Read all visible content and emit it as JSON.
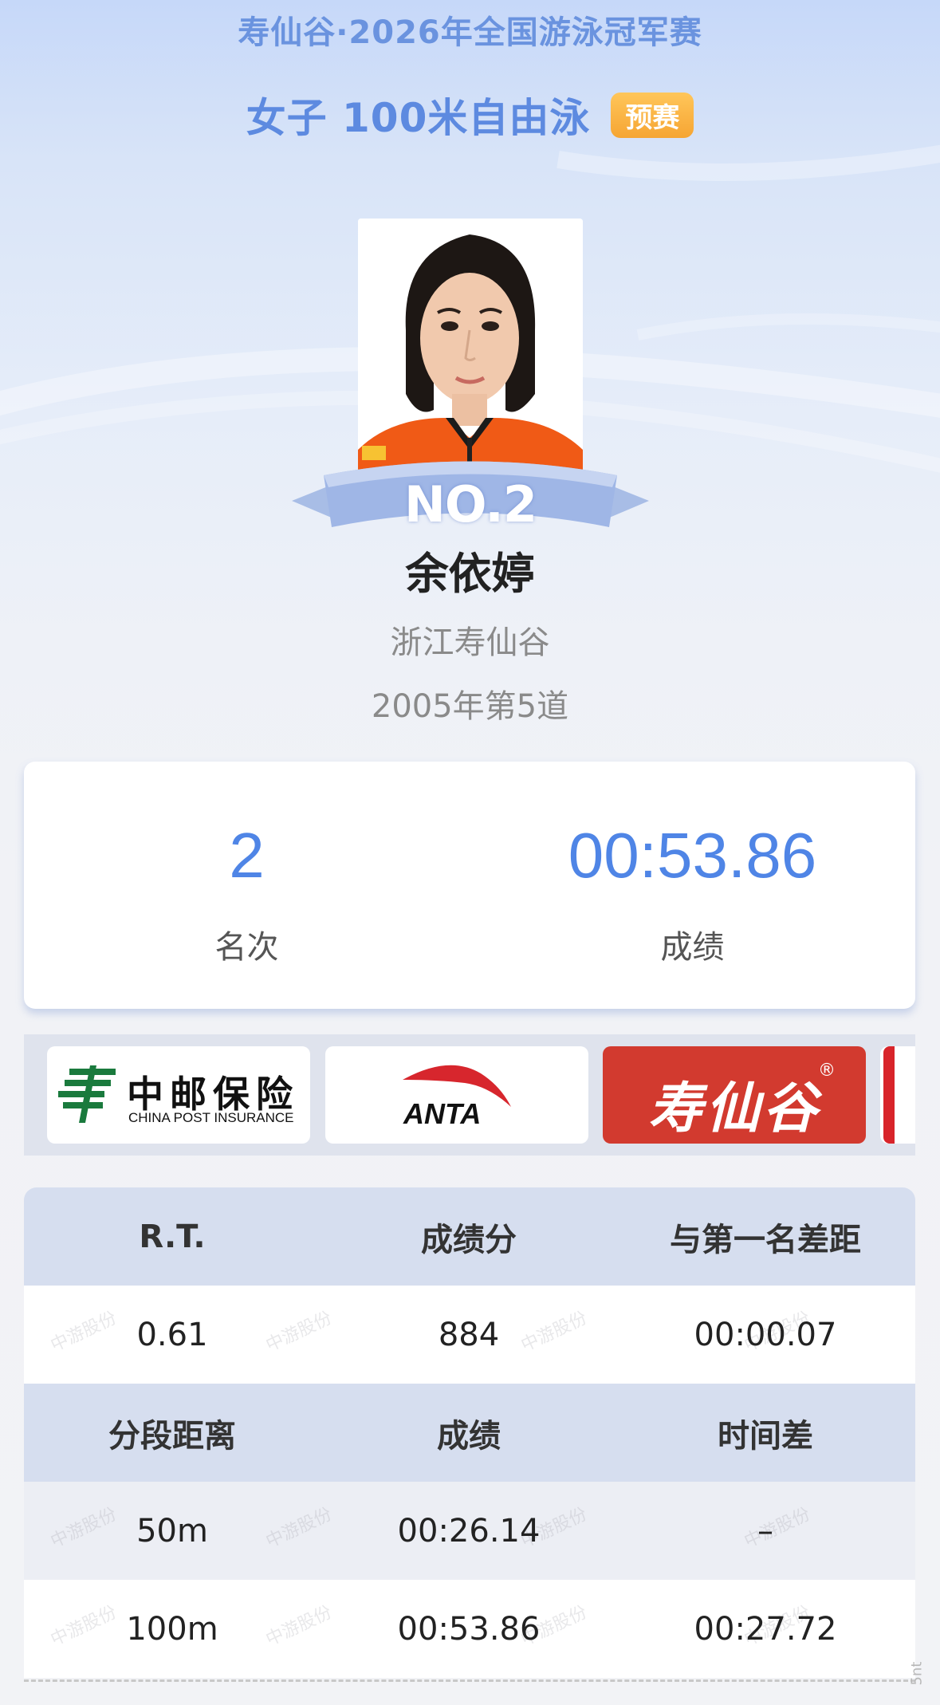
{
  "header": {
    "event_title": "寿仙谷·2026年全国游泳冠军赛",
    "event_name": "女子 100米自由泳",
    "stage_badge": "预赛"
  },
  "athlete": {
    "rank_ribbon": "NO.2",
    "name": "余依婷",
    "team": "浙江寿仙谷",
    "lane_info": "2005年第5道"
  },
  "score_card": {
    "rank_value": "2",
    "rank_label": "名次",
    "time_value": "00:53.86",
    "time_label": "成绩"
  },
  "sponsors": {
    "cpi_cn": "中邮保险",
    "cpi_en": "CHINA POST INSURANCE",
    "anta": "ANTA",
    "sxg": "寿仙谷",
    "sxg_reg": "®"
  },
  "stats": {
    "headers1": [
      "R.T.",
      "成绩分",
      "与第一名差距"
    ],
    "values1": [
      "0.61",
      "884",
      "00:00.07"
    ],
    "headers2": [
      "分段距离",
      "成绩",
      "时间差"
    ],
    "splits": [
      [
        "50m",
        "00:26.14",
        "–"
      ],
      [
        "100m",
        "00:53.86",
        "00:27.72"
      ]
    ]
  },
  "watermark": "中游股份",
  "corner_mark": "5nt",
  "colors": {
    "accent_blue": "#4f85e6",
    "badge_orange": "#f6a533",
    "header_row": "#d6deef",
    "sxg_red": "#d23a2f"
  }
}
